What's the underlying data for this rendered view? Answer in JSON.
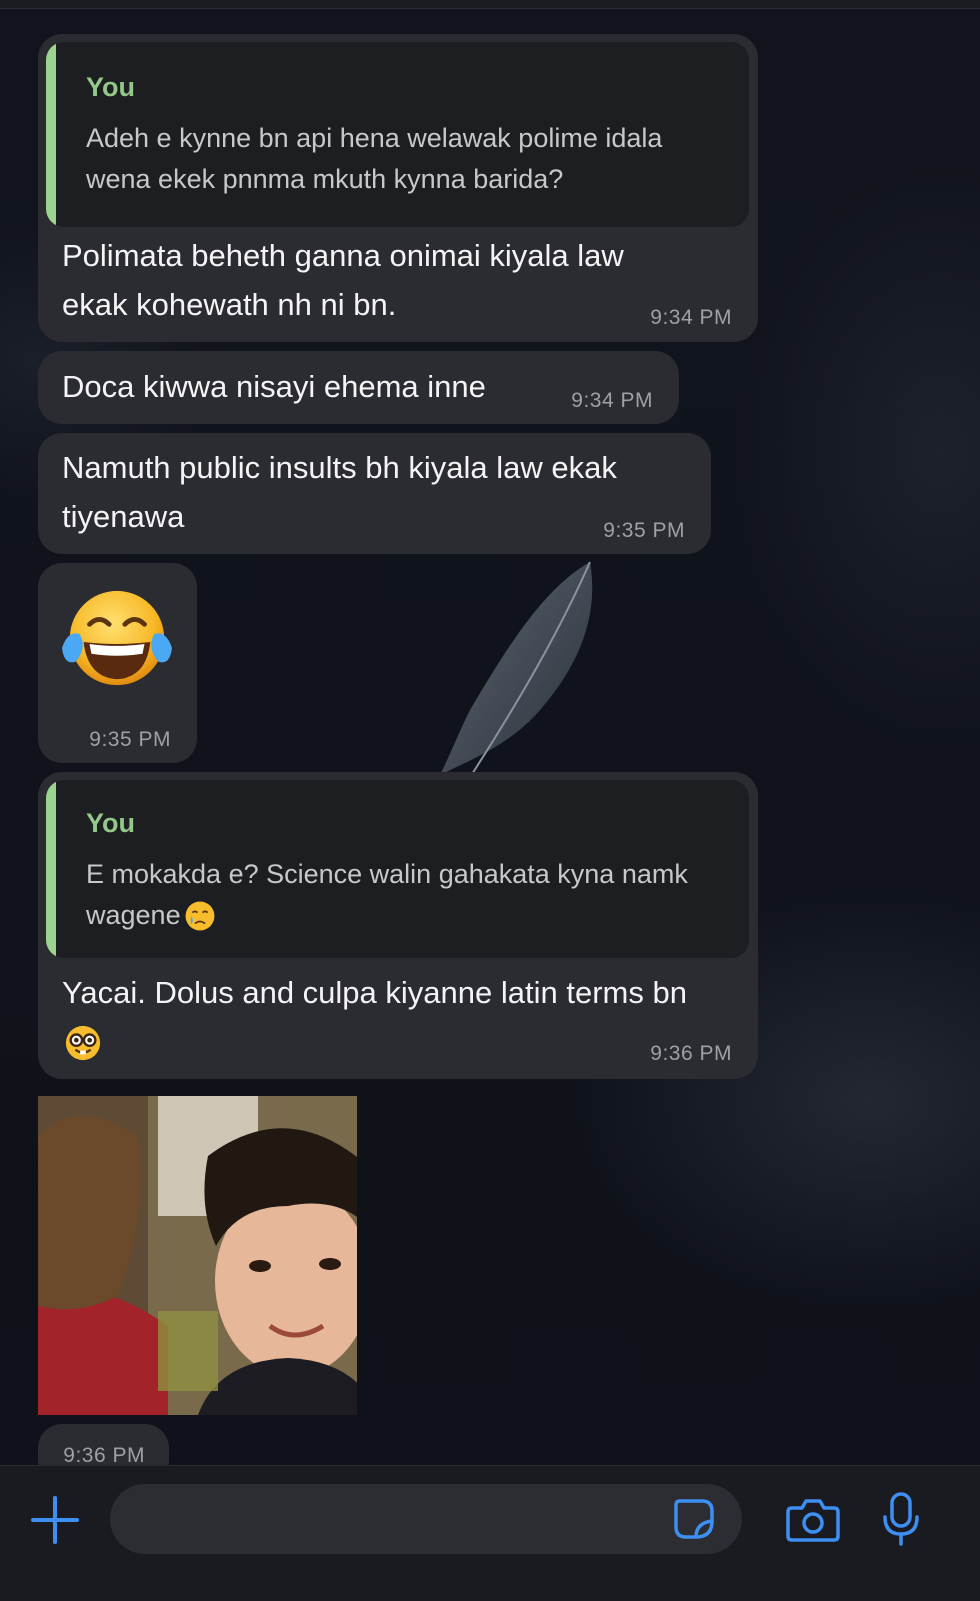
{
  "messages": [
    {
      "quote": {
        "author": "You",
        "lines": [
          "Adeh e kynne bn api hena welawak polime idala",
          "wena ekek pnnma mkuth kynna barida?"
        ]
      },
      "lines": [
        "Polimata beheth ganna onimai kiyala law",
        "ekak kohewath nh ni bn."
      ],
      "time": "9:34 PM"
    },
    {
      "lines": [
        "Doca kiwwa nisayi ehema inne"
      ],
      "time": "9:34 PM"
    },
    {
      "lines": [
        "Namuth public insults bh kiyala law ekak",
        "tiyenawa"
      ],
      "time": "9:35 PM"
    },
    {
      "emoji": "face-with-tears-of-joy",
      "time": "9:35 PM"
    },
    {
      "quote": {
        "author": "You",
        "lines": [
          "E mokakda e? Science walin gahakata kyna namk",
          "wagene"
        ],
        "trailing_emoji": "crying-face"
      },
      "lines": [
        "Yacai. Dolus and culpa kiyanne latin terms bn"
      ],
      "trailing_emoji": "nerd-face",
      "time": "9:36 PM"
    },
    {
      "image": "photo of a smiling child",
      "time": "9:36 PM"
    }
  ],
  "input_bar": {
    "add_icon": "plus-icon",
    "sticker_icon": "sticker-icon",
    "camera_icon": "camera-icon",
    "mic_icon": "microphone-icon",
    "accent": "#3d8ff2"
  },
  "colors": {
    "background": "#0f121a",
    "bubble": "#2b2c31",
    "quote_bar": "#9bd48f",
    "quote_author": "#93c88a"
  }
}
